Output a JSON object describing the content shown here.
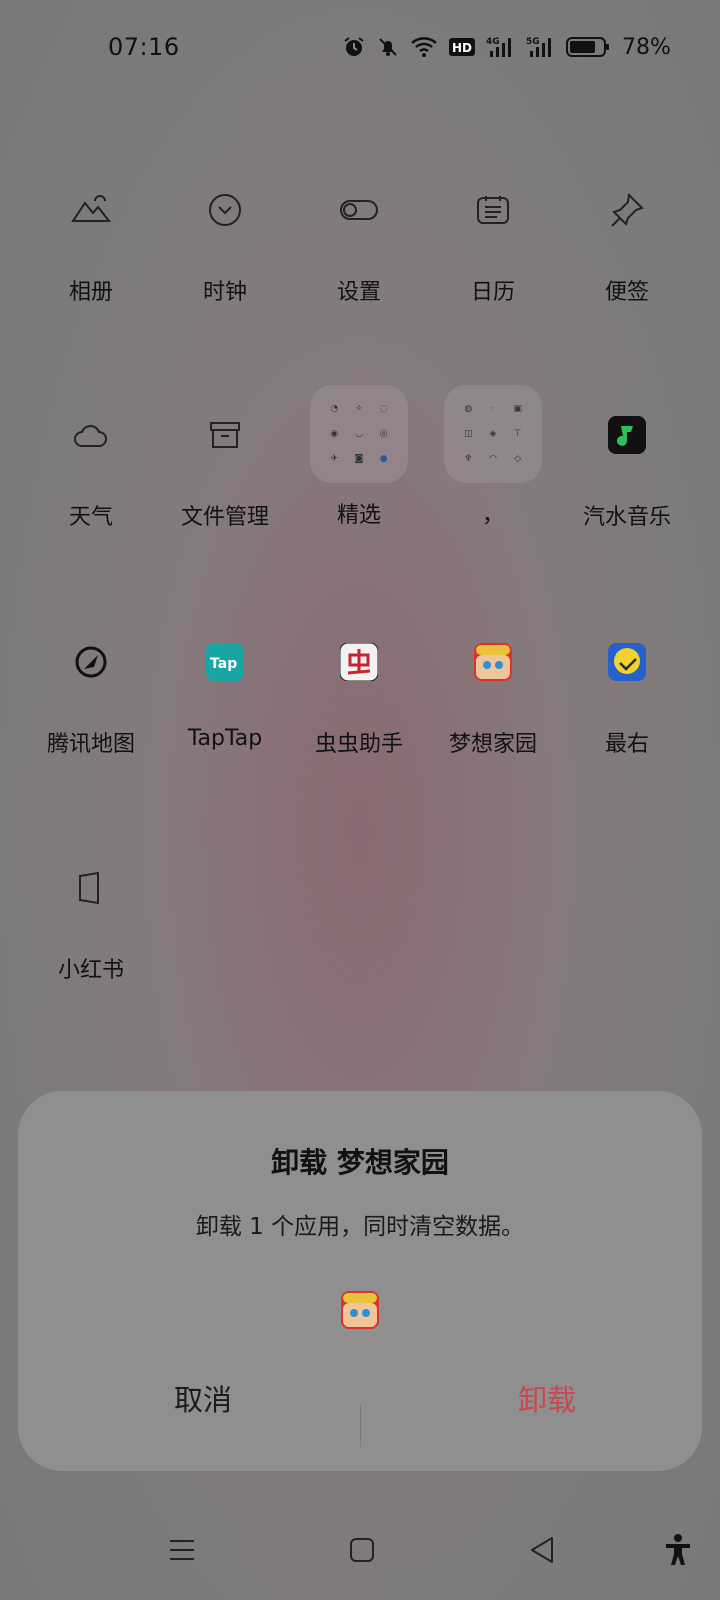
{
  "status_bar": {
    "time": "07:16",
    "battery_percent": "78%",
    "battery_level": 0.78,
    "icons": [
      "alarm-icon",
      "mute-icon",
      "wifi-icon",
      "hd-icon",
      "signal-4g-icon",
      "signal-5g-icon",
      "battery-icon"
    ]
  },
  "apps": [
    {
      "label": "相册",
      "icon": "gallery-icon"
    },
    {
      "label": "时钟",
      "icon": "clock-icon"
    },
    {
      "label": "设置",
      "icon": "settings-icon"
    },
    {
      "label": "日历",
      "icon": "calendar-icon"
    },
    {
      "label": "便签",
      "icon": "notes-icon"
    },
    {
      "label": "天气",
      "icon": "weather-icon"
    },
    {
      "label": "文件管理",
      "icon": "files-icon"
    },
    {
      "label": "精选",
      "icon": "folder-icon"
    },
    {
      "label": "，",
      "icon": "folder-icon"
    },
    {
      "label": "汽水音乐",
      "icon": "music-icon"
    },
    {
      "label": "腾讯地图",
      "icon": "map-icon"
    },
    {
      "label": "TapTap",
      "icon": "taptap-icon"
    },
    {
      "label": "虫虫助手",
      "icon": "chongchong-icon"
    },
    {
      "label": "梦想家园",
      "icon": "dream-home-icon"
    },
    {
      "label": "最右",
      "icon": "zuiyou-icon"
    },
    {
      "label": "小红书",
      "icon": "xiaohongshu-icon"
    }
  ],
  "dialog": {
    "title": "卸载 梦想家园",
    "message": "卸载 1 个应用，同时清空数据。",
    "cancel_label": "取消",
    "confirm_label": "卸载",
    "confirm_color": "#c9484f"
  },
  "navbar": {
    "buttons": [
      "menu-icon",
      "home-icon",
      "back-icon",
      "accessibility-icon"
    ]
  }
}
